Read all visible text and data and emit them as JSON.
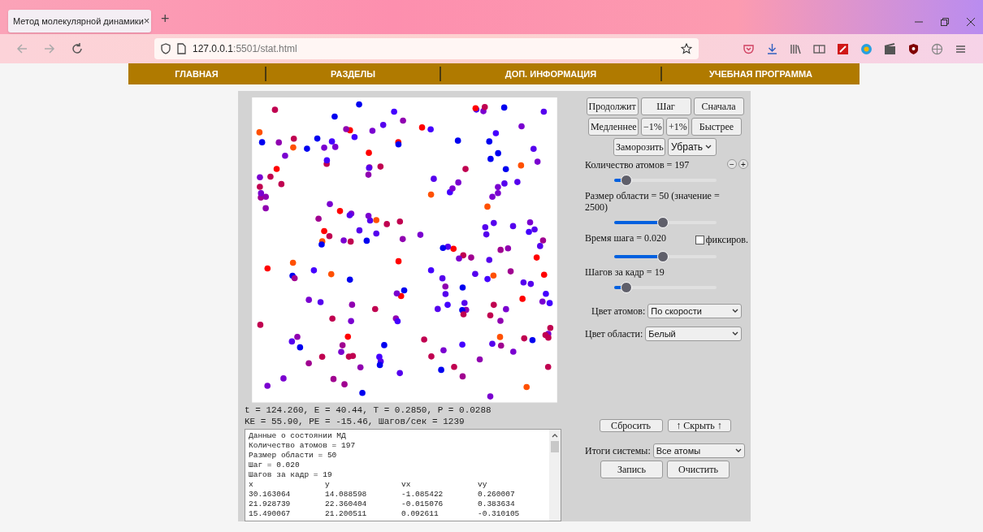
{
  "browser": {
    "tab_title": "Метод молекулярной динамики",
    "tab_close": "×",
    "new_tab": "+",
    "url_host": "127.0.0.1",
    "url_rest": ":5501/stat.html"
  },
  "nav": [
    {
      "label": "ГЛАВНАЯ"
    },
    {
      "label": "РАЗДЕЛЫ"
    },
    {
      "label": "ДОП. ИНФОРМАЦИЯ"
    },
    {
      "label": "УЧЕБНАЯ ПРОГРАММА"
    }
  ],
  "simulation": {
    "status_lines": [
      "t = 124.260, E = 40.44, T = 0.2850, P = 0.0288",
      "KE = 55.90, PE = -15.46, Шагов/сек = 1239"
    ],
    "log": {
      "lines": [
        "Данные о состоянии МД",
        "Количество атомов = 197",
        "Размер области = 50",
        "Шаг = 0.020",
        "Шагов за кадр = 19"
      ],
      "columns": [
        "x",
        "y",
        "vx",
        "vy"
      ],
      "rows": [
        [
          "30.163064",
          "14.088598",
          "-1.085422",
          "0.260007"
        ],
        [
          "21.928739",
          "22.360404",
          "-0.015076",
          "0.383634"
        ],
        [
          "15.490067",
          "21.200511",
          "0.092611",
          "-0.310105"
        ]
      ]
    }
  },
  "controls": {
    "button_rows": [
      [
        "Продолжит",
        "Шаг",
        "Сначала"
      ],
      [
        "Медленнее",
        "−1%",
        "+1%",
        "Быстрее"
      ]
    ],
    "freeze_button": "Заморозить",
    "remove_select": "Убрать",
    "sliders": [
      {
        "label": "Количество атомов = 197",
        "level": 0.12,
        "stepper": {
          "minus": "−",
          "plus": "+"
        }
      },
      {
        "label": "Размер области = 50 (значение = 2500)",
        "level": 0.48
      },
      {
        "label": "Время шага = 0.020",
        "level": 0.48,
        "checkbox": {
          "label": "фиксиров.",
          "checked": false
        }
      },
      {
        "label": "Шагов за кадр = 19",
        "level": 0.12
      }
    ],
    "selects": [
      {
        "label": "Цвет атомов:",
        "value": "По скорости"
      },
      {
        "label": "Цвет области:",
        "value": "Белый"
      }
    ],
    "reset_button": "Сбросить",
    "hide_button": "↑ Скрыть ↑",
    "summary": {
      "label": "Итоги системы:",
      "value": "Все атомы"
    },
    "record_button": "Запись",
    "clear_button": "Очистить"
  }
}
